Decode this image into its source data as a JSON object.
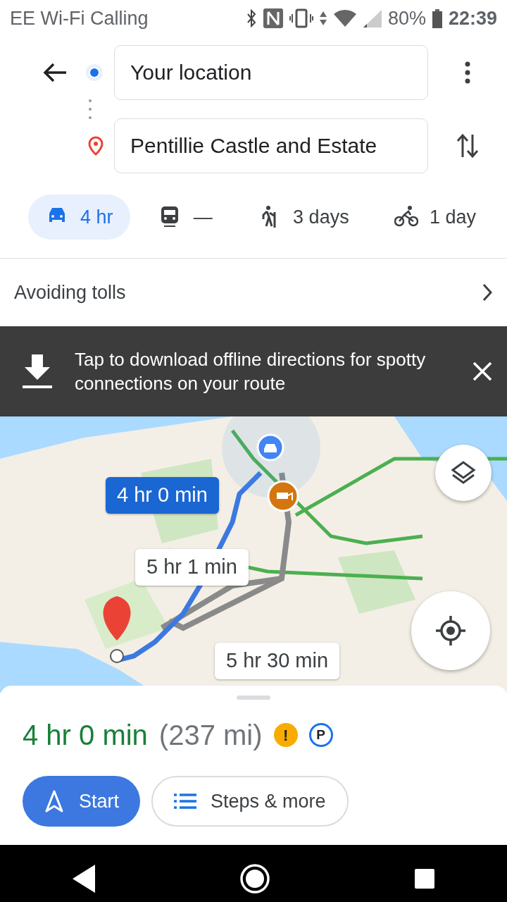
{
  "status_bar": {
    "carrier": "EE Wi-Fi Calling",
    "battery": "80%",
    "time": "22:39"
  },
  "route_inputs": [
    {
      "kind": "origin",
      "value": "Your location"
    },
    {
      "kind": "destination",
      "value": "Pentillie Castle and Estate"
    }
  ],
  "modes": [
    {
      "kind": "car",
      "label": "4 hr",
      "selected": true
    },
    {
      "kind": "transit",
      "label": "—",
      "selected": false
    },
    {
      "kind": "walk",
      "label": "3 days",
      "selected": false
    },
    {
      "kind": "bike",
      "label": "1 day",
      "selected": false
    }
  ],
  "options_row": {
    "label": "Avoiding tolls"
  },
  "banner": {
    "text": "Tap to download offline directions for spotty connections on your route"
  },
  "map": {
    "kind": "picture",
    "route_labels": [
      {
        "text": "4 hr 0 min",
        "selected": true
      },
      {
        "text": "5 hr 1 min",
        "selected": false
      },
      {
        "text": "5 hr 30 min",
        "selected": false
      }
    ]
  },
  "summary": {
    "duration": "4 hr 0 min",
    "distance": "(237 mi)",
    "badges": [
      {
        "kind": "warning",
        "text": "!"
      },
      {
        "kind": "parking",
        "text": "P"
      }
    ]
  },
  "buttons": [
    {
      "kind": "start",
      "label": "Start"
    },
    {
      "kind": "steps",
      "label": "Steps & more"
    }
  ]
}
